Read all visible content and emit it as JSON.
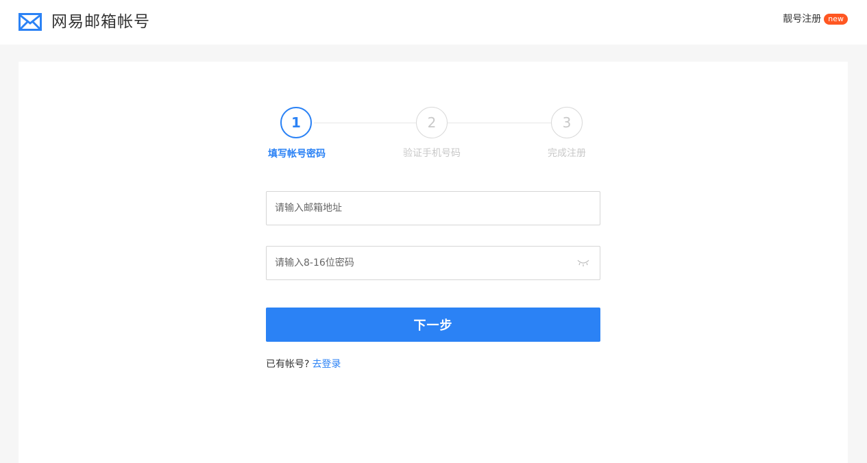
{
  "header": {
    "logo_icon": "mail-envelope-icon",
    "brand_title": "网易邮箱帐号",
    "premium_link": "靓号注册",
    "new_badge": "new",
    "accent_color": "#2b82f5",
    "badge_color": "#ff5722"
  },
  "steps": [
    {
      "number": "1",
      "label": "填写帐号密码",
      "active": true
    },
    {
      "number": "2",
      "label": "验证手机号码",
      "active": false
    },
    {
      "number": "3",
      "label": "完成注册",
      "active": false
    }
  ],
  "form": {
    "email_placeholder": "请输入邮箱地址",
    "email_value": "",
    "password_placeholder": "请输入8-16位密码",
    "password_value": "",
    "password_toggle_icon": "eye-closed-icon",
    "next_button": "下一步"
  },
  "footer": {
    "have_account_text": "已有帐号?",
    "login_link": "去登录"
  }
}
